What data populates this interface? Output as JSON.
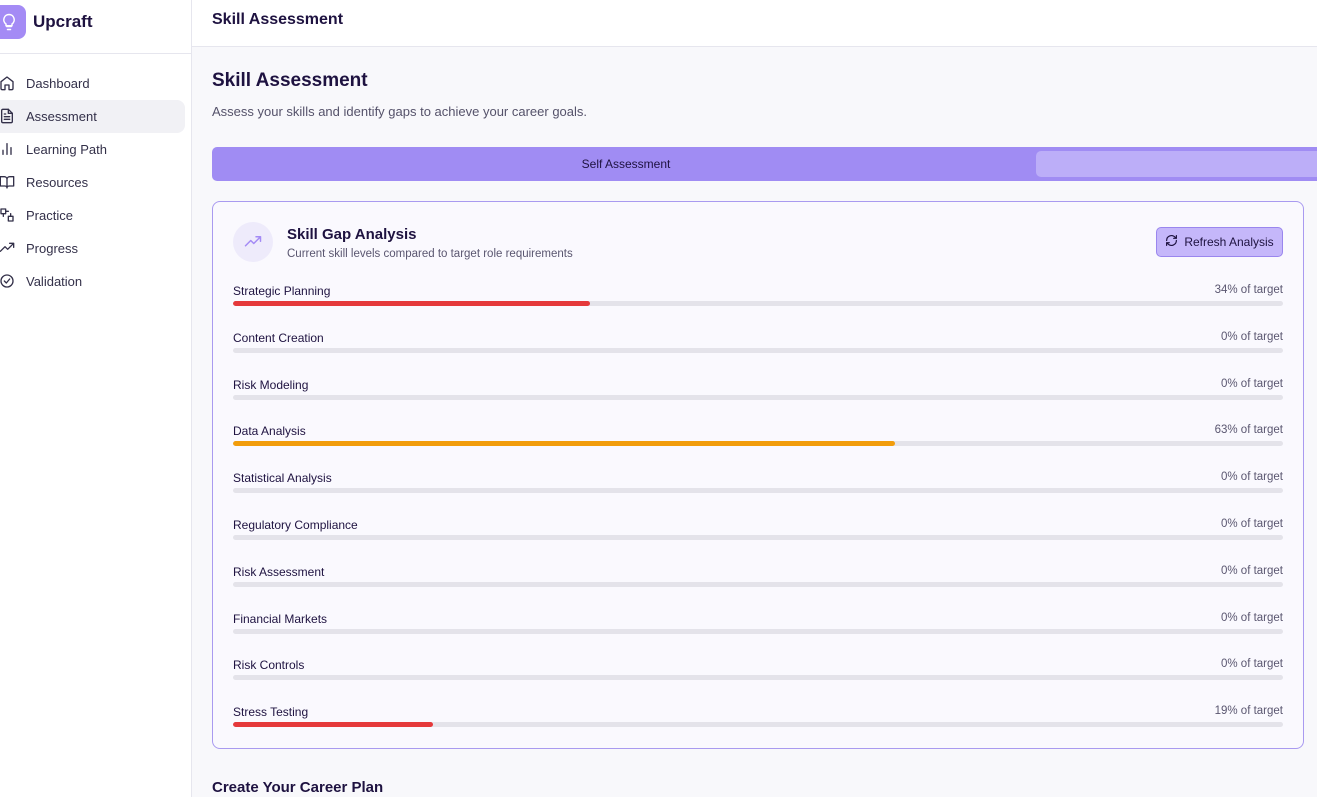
{
  "brand": {
    "name": "Upcraft"
  },
  "sidebar": {
    "items": [
      {
        "label": "Dashboard",
        "icon": "home-icon",
        "active": false
      },
      {
        "label": "Assessment",
        "icon": "document-icon",
        "active": true
      },
      {
        "label": "Learning Path",
        "icon": "bar-chart-icon",
        "active": false
      },
      {
        "label": "Resources",
        "icon": "book-icon",
        "active": false
      },
      {
        "label": "Practice",
        "icon": "puzzle-icon",
        "active": false
      },
      {
        "label": "Progress",
        "icon": "trending-up-icon",
        "active": false
      },
      {
        "label": "Validation",
        "icon": "check-circle-icon",
        "active": false
      }
    ]
  },
  "header": {
    "title": "Skill Assessment"
  },
  "main": {
    "title": "Skill Assessment",
    "subtitle": "Assess your skills and identify gaps to achieve your career goals.",
    "tabs": [
      {
        "label": "Self Assessment",
        "active": true
      },
      {
        "label": "",
        "active": false
      }
    ],
    "gap_card": {
      "title": "Skill Gap Analysis",
      "subtitle": "Current skill levels compared to target role requirements",
      "refresh_label": "Refresh Analysis",
      "skills": [
        {
          "name": "Strategic Planning",
          "percent": 34,
          "label": "34% of target",
          "color": "#e5393b"
        },
        {
          "name": "Content Creation",
          "percent": 0,
          "label": "0% of target",
          "color": "#e5393b"
        },
        {
          "name": "Risk Modeling",
          "percent": 0,
          "label": "0% of target",
          "color": "#e5393b"
        },
        {
          "name": "Data Analysis",
          "percent": 63,
          "label": "63% of target",
          "color": "#f29d0c"
        },
        {
          "name": "Statistical Analysis",
          "percent": 0,
          "label": "0% of target",
          "color": "#e5393b"
        },
        {
          "name": "Regulatory Compliance",
          "percent": 0,
          "label": "0% of target",
          "color": "#e5393b"
        },
        {
          "name": "Risk Assessment",
          "percent": 0,
          "label": "0% of target",
          "color": "#e5393b"
        },
        {
          "name": "Financial Markets",
          "percent": 0,
          "label": "0% of target",
          "color": "#e5393b"
        },
        {
          "name": "Risk Controls",
          "percent": 0,
          "label": "0% of target",
          "color": "#e5393b"
        },
        {
          "name": "Stress Testing",
          "percent": 19,
          "label": "19% of target",
          "color": "#e5393b"
        }
      ]
    },
    "next_section_title": "Create Your Career Plan"
  },
  "colors": {
    "accent": "#a08cf3",
    "card_border": "#a99af0",
    "low": "#e5393b",
    "mid": "#f29d0c"
  }
}
